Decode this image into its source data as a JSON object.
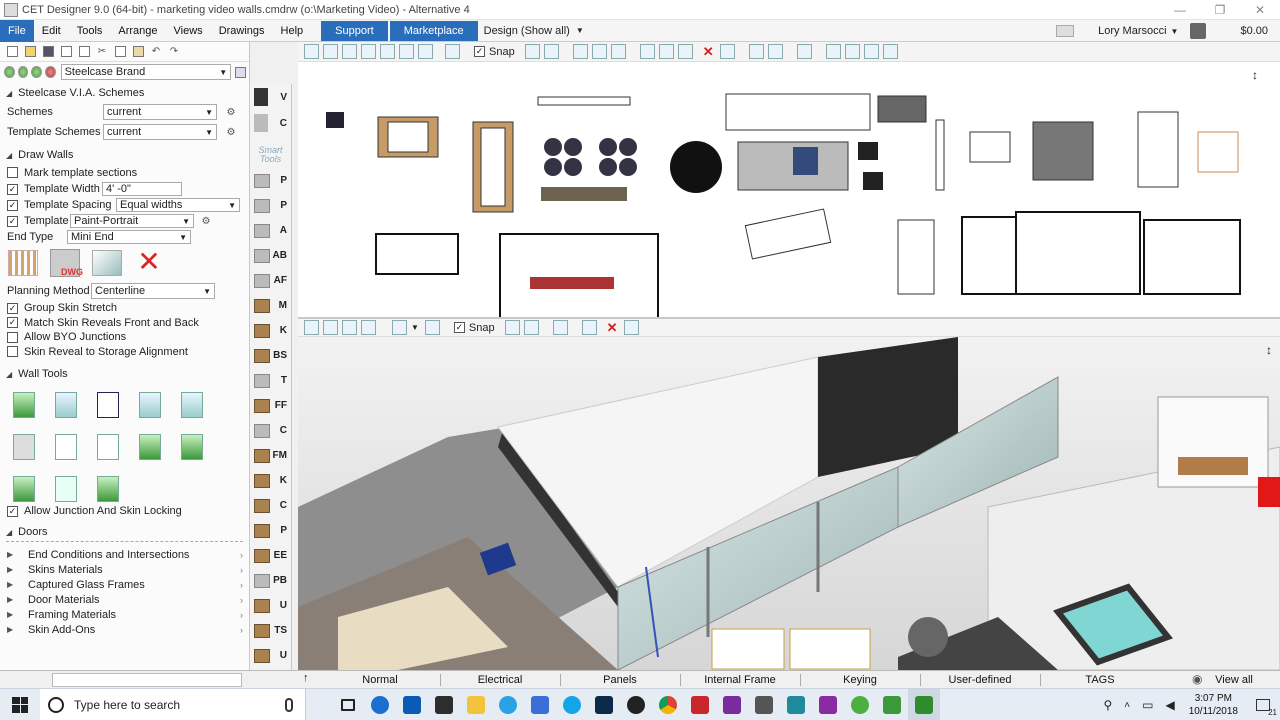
{
  "window": {
    "title": "CET Designer 9.0 (64-bit) - marketing video walls.cmdrw (o:\\Marketing Video) - Alternative 4",
    "controls": [
      "—",
      "❐",
      "✕"
    ]
  },
  "menu": {
    "items": [
      "File",
      "Edit",
      "Tools",
      "Arrange",
      "Views",
      "Drawings",
      "Help"
    ],
    "support": "Support",
    "marketplace": "Marketplace",
    "design_filter": "Design (Show all)",
    "user": "Lory Marsocci",
    "price": "$0.00"
  },
  "left_panel": {
    "brand": "Steelcase Brand",
    "via_section": "Steelcase V.I.A. Schemes",
    "schemes_label": "Schemes",
    "schemes_value": "current",
    "template_schemes_label": "Template Schemes",
    "template_schemes_value": "current",
    "draw_walls_section": "Draw Walls",
    "mark_template": "Mark template sections",
    "template_width_label": "Template Width",
    "template_width_value": "4' -0\"",
    "template_spacing_label": "Template Spacing",
    "template_spacing_value": "Equal widths",
    "template_label": "Template",
    "template_value": "Paint-Portrait",
    "end_type_label": "End Type",
    "end_type_value": "Mini End",
    "dwg_label": "DWG",
    "planning_method_label": "Planning Method",
    "planning_method_value": "Centerline",
    "group_skin_stretch": "Group Skin Stretch",
    "match_skin": "Match Skin Reveals Front and Back",
    "allow_byo": "Allow BYO Junctions",
    "skin_reveal": "Skin Reveal to Storage Alignment",
    "wall_tools_section": "Wall Tools",
    "allow_junction": "Allow Junction And Skin Locking",
    "doors_section": "Doors",
    "accordion": [
      "End Conditions and Intersections",
      "Skins Materials",
      "Captured Glass Frames",
      "Door Materials",
      "Framing Materials",
      "Skin Add-Ons"
    ]
  },
  "smart_tools": {
    "label": "Smart Tools",
    "top_letters": [
      "V",
      "C"
    ],
    "letters": [
      "P",
      "P",
      "A",
      "AB",
      "AF",
      "M",
      "K",
      "BS",
      "T",
      "FF",
      "C",
      "FM",
      "K",
      "C",
      "P",
      "EE",
      "PB",
      "U",
      "TS",
      "U"
    ]
  },
  "view_toolbar": {
    "snap_label": "Snap"
  },
  "tabs": [
    "Normal",
    "Electrical",
    "Panels",
    "Internal Frame",
    "Keying",
    "User-defined",
    "TAGS",
    "View all"
  ],
  "taskbar": {
    "search_placeholder": "Type here to search",
    "time": "3:07 PM",
    "date": "10/11/2018",
    "notifications": "21"
  },
  "colors": {
    "accent": "#2a6ebb",
    "wood": "#a9824f",
    "glass": "#b8d0cf"
  }
}
